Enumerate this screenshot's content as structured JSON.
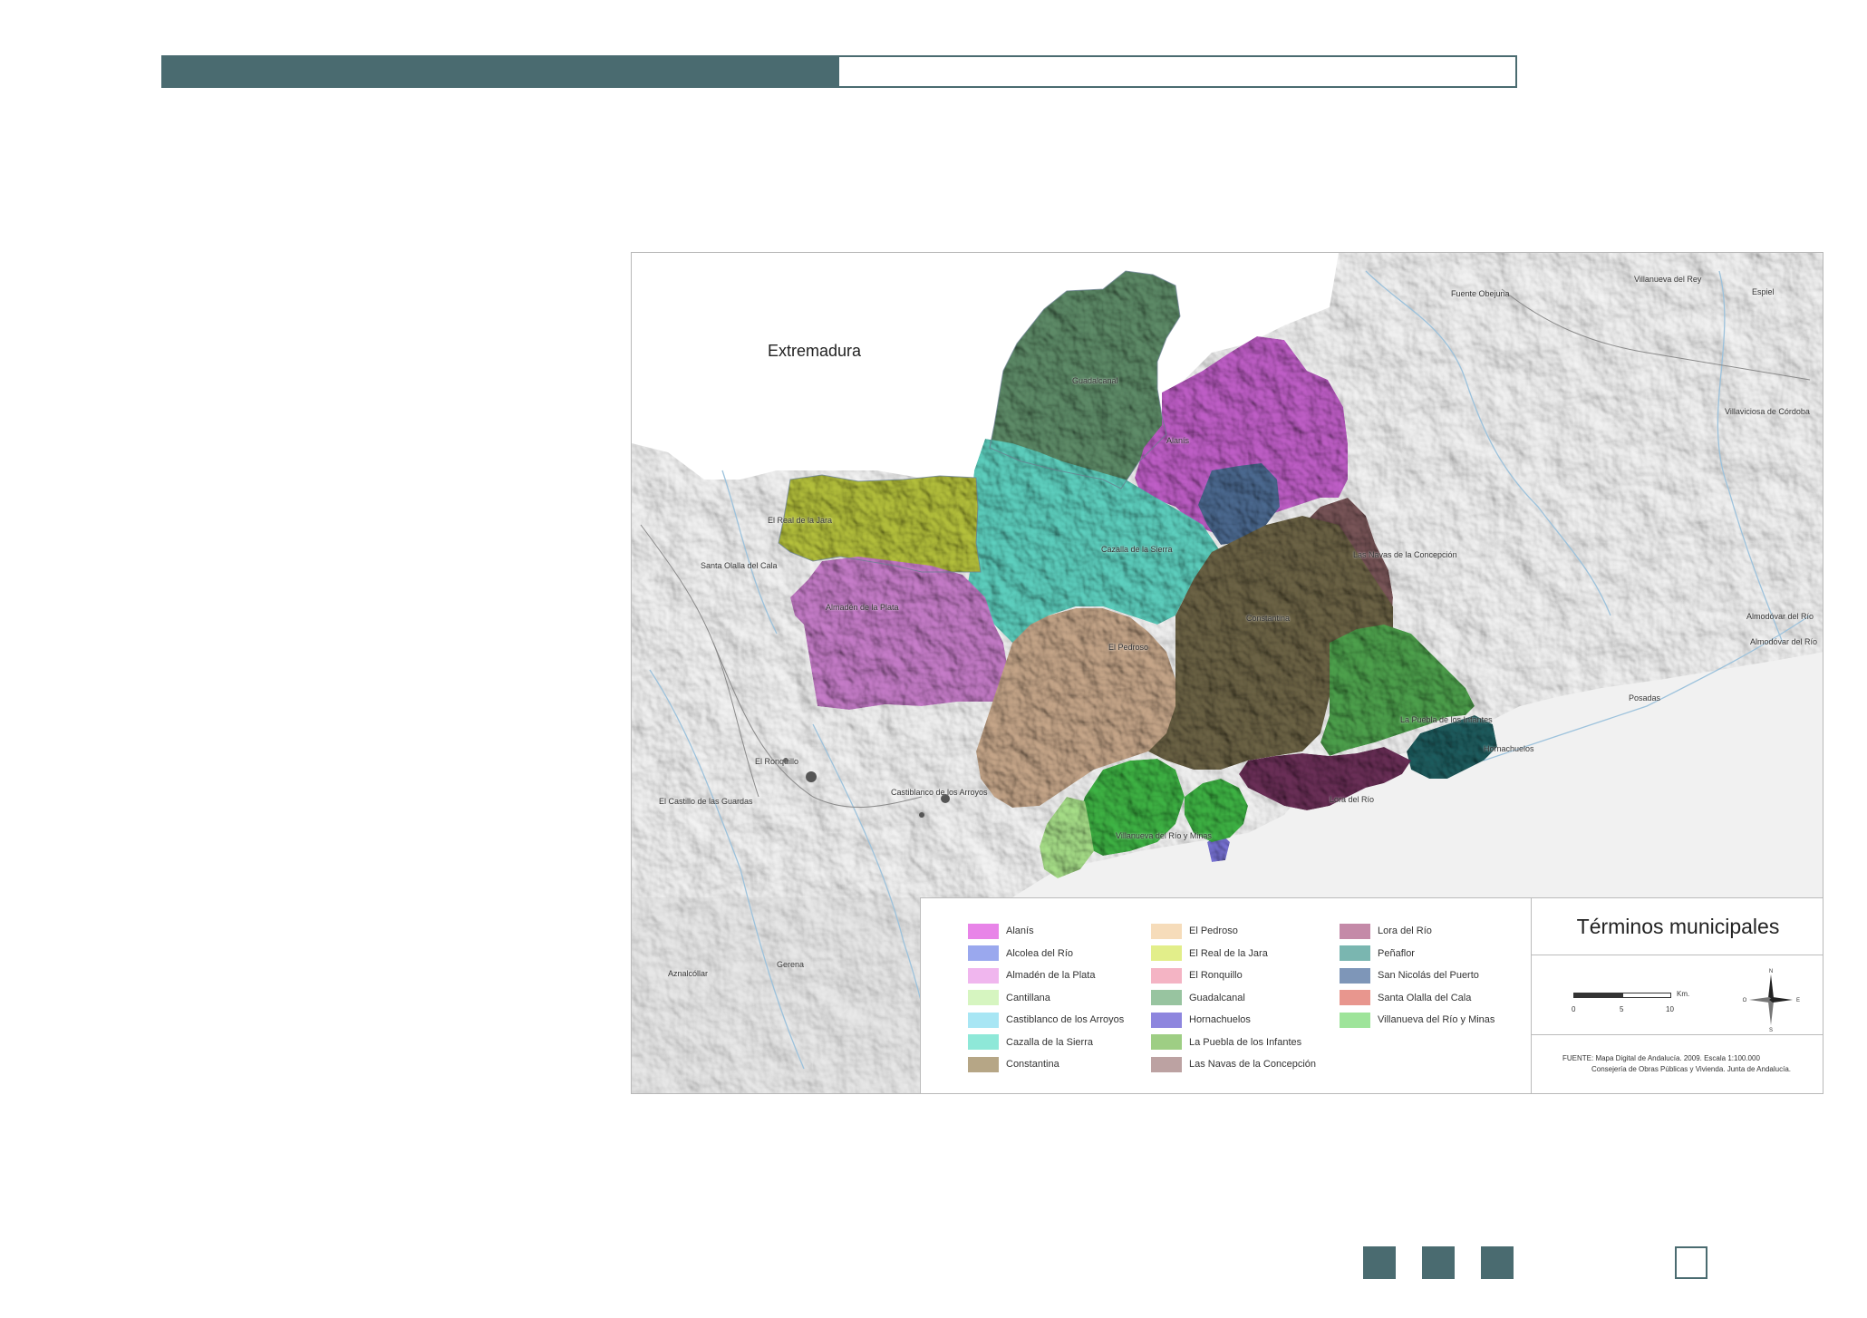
{
  "map": {
    "region_label": "Extremadura",
    "place_labels": {
      "guadalcanal": "Guadalcanal",
      "alanis": "Alanís",
      "real_jara": "El Real de la Jara",
      "santa_olalla": "Santa Olalla del Cala",
      "almaden": "Almadén de la Plata",
      "cazalla": "Cazalla de la Sierra",
      "navas": "Las Navas de la Concepción",
      "el_pedroso": "El Pedroso",
      "constantina": "Constantina",
      "puebla": "La Puebla de los Infantes",
      "hornachuelos": "Hornachuelos",
      "lora": "Lora del Río",
      "villanueva": "Villanueva del Río y Minas",
      "el_ronquillo": "El Ronquillo",
      "castillo_guardas": "El Castillo de las Guardas",
      "castiblanco": "Castiblanco de los Arroyos",
      "posadas": "Posadas",
      "almodovar1": "Almodóvar del Río",
      "almodovar2": "Almodóvar del Río",
      "villanueva_rey": "Villanueva del Rey",
      "villaviciosa": "Villaviciosa de Córdoba",
      "fuente_obejuna": "Fuente Obejuna",
      "espiel": "Espiel",
      "gerena": "Gerena",
      "aznalcollar": "Aznalcóllar"
    }
  },
  "legend": {
    "columns": [
      [
        {
          "label": "Alanís",
          "color": "#e884e8"
        },
        {
          "label": "Alcolea del Río",
          "color": "#9aa8ee"
        },
        {
          "label": "Almadén de la Plata",
          "color": "#f0b6ee"
        },
        {
          "label": "Cantillana",
          "color": "#d6f5c0"
        },
        {
          "label": "Castiblanco de los Arroyos",
          "color": "#a8e6f4"
        },
        {
          "label": "Cazalla de la Sierra",
          "color": "#8ee8d8"
        },
        {
          "label": "Constantina",
          "color": "#b6a686"
        }
      ],
      [
        {
          "label": "El Pedroso",
          "color": "#f6dcba"
        },
        {
          "label": "El Real de la Jara",
          "color": "#e2ee8a"
        },
        {
          "label": "El Ronquillo",
          "color": "#f4b4c4"
        },
        {
          "label": "Guadalcanal",
          "color": "#98c4a0"
        },
        {
          "label": "Hornachuelos",
          "color": "#8e86de"
        },
        {
          "label": "La Puebla de los Infantes",
          "color": "#9ece84"
        },
        {
          "label": "Las Navas de la Concepción",
          "color": "#bca2a2"
        }
      ],
      [
        {
          "label": "Lora del Río",
          "color": "#c48aa8"
        },
        {
          "label": "Peñaflor",
          "color": "#7ab6b0"
        },
        {
          "label": "San Nicolás del Puerto",
          "color": "#7e96b8"
        },
        {
          "label": "Santa Olalla del Cala",
          "color": "#e8968e"
        },
        {
          "label": "Villanueva del Río y Minas",
          "color": "#9ee49a"
        }
      ]
    ]
  },
  "title_box": {
    "title": "Términos municipales",
    "scale_unit": "Km.",
    "scale_ticks": [
      "0",
      "5",
      "10"
    ],
    "compass": {
      "n": "N",
      "s": "S",
      "e": "E",
      "w": "O"
    },
    "source_line1": "FUENTE: Mapa Digital de Andalucía. 2009. Escala 1:100.000",
    "source_line2": "Consejería de Obras Públicas y Vivienda. Junta de Andalucía."
  },
  "colors": {
    "accent": "#4a6b70"
  }
}
